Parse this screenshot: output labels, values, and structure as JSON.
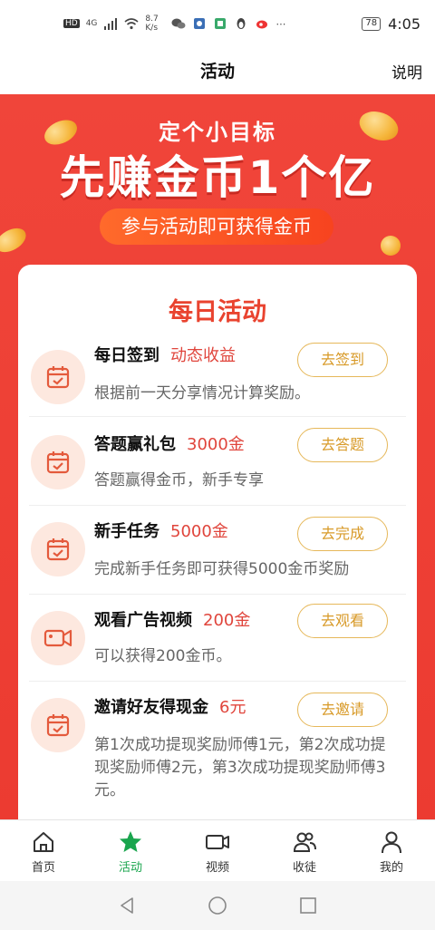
{
  "status_bar": {
    "hd": "HD",
    "net": "4G",
    "speed": "8.7 K/s",
    "battery": "78",
    "time": "4:05",
    "icons": [
      "wechat-icon",
      "app-icon",
      "reader-icon",
      "penguin-icon",
      "weibo-icon",
      "more-icon"
    ]
  },
  "nav": {
    "title": "活动",
    "help": "说明"
  },
  "hero": {
    "subtitle": "定个小目标",
    "title": "先赚金币1个亿",
    "pill": "参与活动即可获得金币"
  },
  "card": {
    "title": "每日活动",
    "tasks": [
      {
        "name": "每日签到",
        "reward": "动态收益",
        "button": "去签到",
        "desc": "根据前一天分享情况计算奖励。",
        "icon": "calendar-check-icon"
      },
      {
        "name": "答题赢礼包",
        "reward": "3000金",
        "button": "去答题",
        "desc": "答题赢得金币，新手专享",
        "icon": "calendar-check-icon"
      },
      {
        "name": "新手任务",
        "reward": "5000金",
        "button": "去完成",
        "desc": "完成新手任务即可获得5000金币奖励",
        "icon": "calendar-check-icon"
      },
      {
        "name": "观看广告视频",
        "reward": "200金",
        "button": "去观看",
        "desc": "可以获得200金币。",
        "icon": "video-camera-icon"
      },
      {
        "name": "邀请好友得现金",
        "reward": "6元",
        "button": "去邀请",
        "desc": "第1次成功提现奖励师傅1元，第2次成功提现奖励师傅2元，第3次成功提现奖励师傅3元。",
        "icon": "calendar-check-icon"
      }
    ]
  },
  "tabs": [
    {
      "label": "首页",
      "icon": "home-icon"
    },
    {
      "label": "活动",
      "icon": "star-icon",
      "active": true
    },
    {
      "label": "视频",
      "icon": "video-icon"
    },
    {
      "label": "收徒",
      "icon": "users-icon"
    },
    {
      "label": "我的",
      "icon": "user-icon"
    }
  ],
  "colors": {
    "primary_red": "#ec3b31",
    "active_green": "#1aa54e",
    "gold": "#d89a28"
  }
}
